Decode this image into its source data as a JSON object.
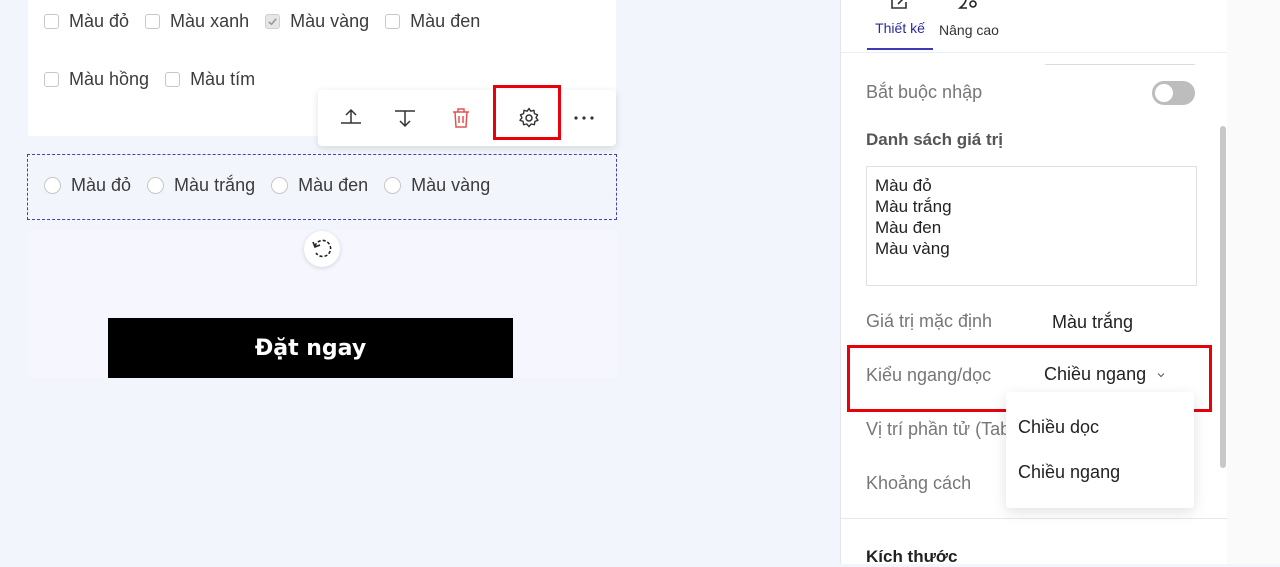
{
  "checkbox_group": {
    "row1": [
      {
        "label": "Màu đỏ",
        "checked": false
      },
      {
        "label": "Màu xanh",
        "checked": false
      },
      {
        "label": "Màu vàng",
        "checked": true
      },
      {
        "label": "Màu đen",
        "checked": false
      }
    ],
    "row2": [
      {
        "label": "Màu hồng",
        "checked": false
      },
      {
        "label": "Màu tím",
        "checked": false
      }
    ]
  },
  "toolbar": {
    "icons": [
      "move-up-icon",
      "move-down-icon",
      "trash-icon",
      "gear-icon",
      "more-icon"
    ],
    "delete_color": "#e05353",
    "highlight_color": "#e8000b"
  },
  "radio_group": {
    "options": [
      "Màu đỏ",
      "Màu trắng",
      "Màu đen",
      "Màu vàng"
    ]
  },
  "cta": {
    "label": "Đặt ngay"
  },
  "panel": {
    "tabs": [
      {
        "label": "Thiết kế",
        "icon": "edit-icon",
        "active": true
      },
      {
        "label": "Nâng cao",
        "icon": "advanced-settings-icon",
        "active": false
      }
    ],
    "required_label": "Bắt buộc nhập",
    "required_on": false,
    "values_title": "Danh sách giá trị",
    "values_list": [
      "Màu đỏ",
      "Màu trắng",
      "Màu đen",
      "Màu vàng"
    ],
    "default_label": "Giá trị mặc định",
    "default_value": "Màu trắng",
    "orientation_label": "Kiểu ngang/dọc",
    "orientation_value": "Chiều ngang",
    "position_label": "Vị trí phần tử (Tab",
    "spacing_label": "Khoảng cách",
    "size_title": "Kích thước",
    "dropdown_options": [
      "Chiều dọc",
      "Chiều ngang"
    ],
    "accent_color": "#3b3bb8"
  }
}
